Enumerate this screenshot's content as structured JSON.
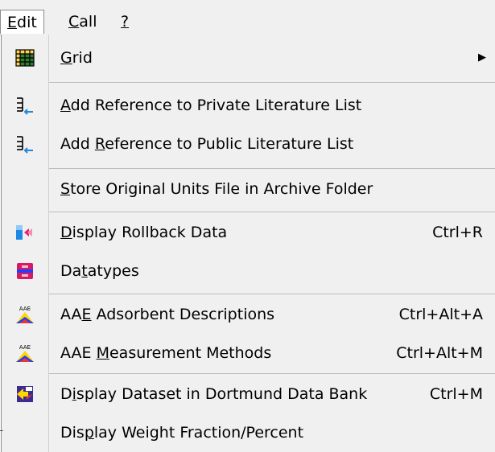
{
  "menubar": {
    "items": [
      {
        "label_pre": "",
        "label_ul": "E",
        "label_post": "dit"
      },
      {
        "label_pre": "",
        "label_ul": "C",
        "label_post": "all"
      },
      {
        "label_pre": "",
        "label_ul": "?",
        "label_post": ""
      }
    ]
  },
  "menu": {
    "items": [
      {
        "icon": "grid-icon",
        "pre": "",
        "ul": "G",
        "post": "rid",
        "shortcut": "",
        "submenu": true
      },
      {
        "icon": "add-reference-icon",
        "pre": "",
        "ul": "A",
        "post": "dd Reference to Private Literature List",
        "shortcut": ""
      },
      {
        "icon": "add-reference-icon",
        "pre": "Add ",
        "ul": "R",
        "post": "eference to Public Literature List",
        "shortcut": ""
      },
      {
        "icon": "",
        "pre": "",
        "ul": "S",
        "post": "tore Original Units File in Archive Folder",
        "shortcut": ""
      },
      {
        "icon": "rollback-icon",
        "pre": "",
        "ul": "D",
        "post": "isplay Rollback Data",
        "shortcut": "Ctrl+R"
      },
      {
        "icon": "datatypes-icon",
        "pre": "Da",
        "ul": "t",
        "post": "atypes",
        "shortcut": ""
      },
      {
        "icon": "aae-icon",
        "pre": "AA",
        "ul": "E",
        "post": " Adsorbent Descriptions",
        "shortcut": "Ctrl+Alt+A"
      },
      {
        "icon": "aae-icon",
        "pre": "AAE ",
        "ul": "M",
        "post": "easurement Methods",
        "shortcut": "Ctrl+Alt+M"
      },
      {
        "icon": "dortmund-icon",
        "pre": "D",
        "ul": "i",
        "post": "splay Dataset in Dortmund Data Bank",
        "shortcut": "Ctrl+M"
      },
      {
        "icon": "",
        "pre": "Dis",
        "ul": "p",
        "post": "lay Weight Fraction/Percent",
        "shortcut": ""
      }
    ]
  },
  "colors": {
    "menu_bg": "#f0f0f0",
    "separator": "#bdbdbd",
    "grid_icon": "#2e7d32",
    "rollback_blue": "#1e88e5",
    "rollback_pink": "#e91e63",
    "datatypes_pink": "#d81b60",
    "aae_red": "#e53935",
    "aae_blue": "#1e40ff",
    "aae_yellow": "#ffd600"
  }
}
